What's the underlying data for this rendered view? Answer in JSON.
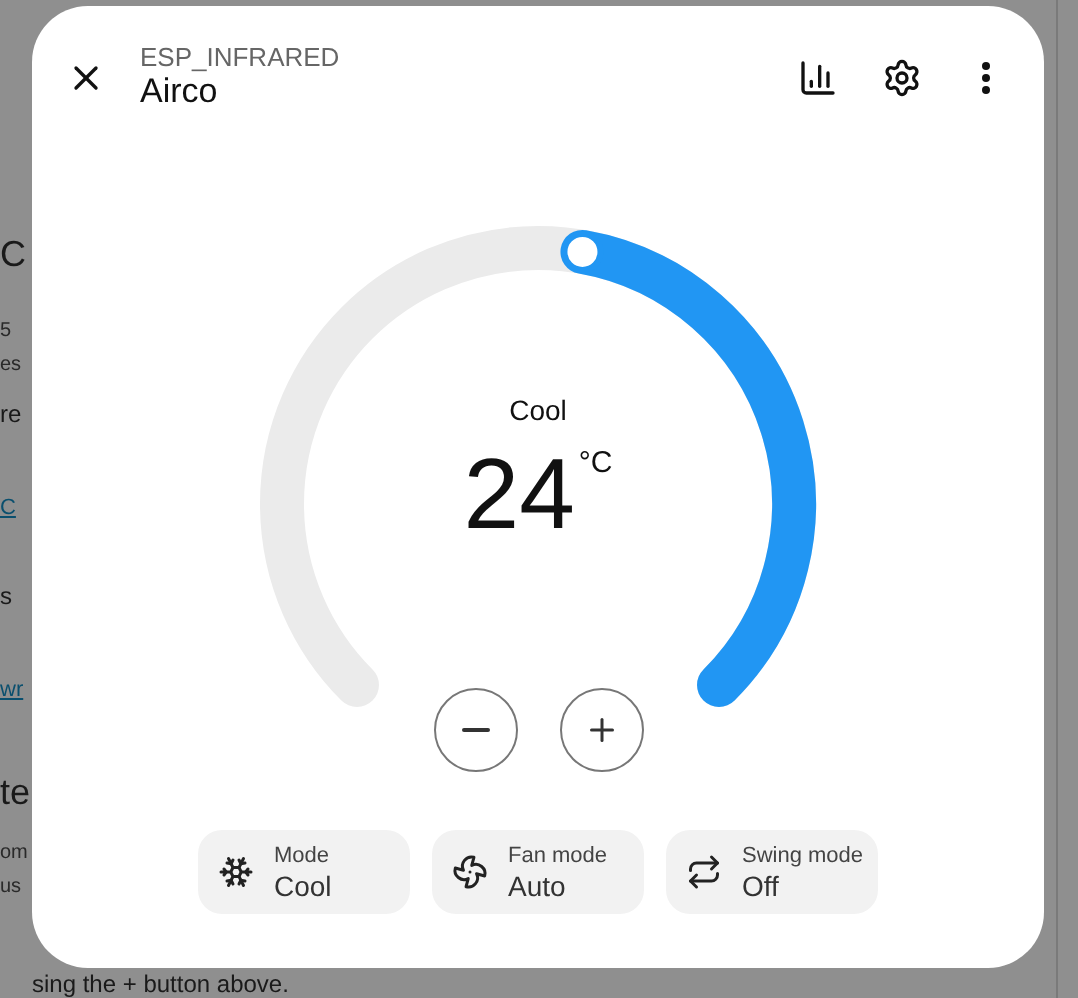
{
  "background_page": {
    "fragments": [
      {
        "text": "C",
        "kind": "heading"
      },
      {
        "text": "5",
        "kind": "small"
      },
      {
        "text": "es",
        "kind": "small"
      },
      {
        "text": "re",
        "kind": "body"
      },
      {
        "text": "C",
        "kind": "link"
      },
      {
        "text": "s",
        "kind": "body"
      },
      {
        "text": "wr",
        "kind": "link"
      },
      {
        "text": "te",
        "kind": "heading"
      },
      {
        "text": "om",
        "kind": "small"
      },
      {
        "text": "us",
        "kind": "small"
      }
    ],
    "footer_text": "sing the + button above."
  },
  "dialog": {
    "subtitle": "ESP_INFRARED",
    "title": "Airco",
    "thermostat": {
      "mode_label": "Cool",
      "target": "24",
      "unit": "°C"
    },
    "chips": [
      {
        "kind": "mode",
        "label": "Mode",
        "value": "Cool"
      },
      {
        "kind": "fan",
        "label": "Fan mode",
        "value": "Auto"
      },
      {
        "kind": "swing",
        "label": "Swing mode",
        "value": "Off"
      }
    ]
  }
}
